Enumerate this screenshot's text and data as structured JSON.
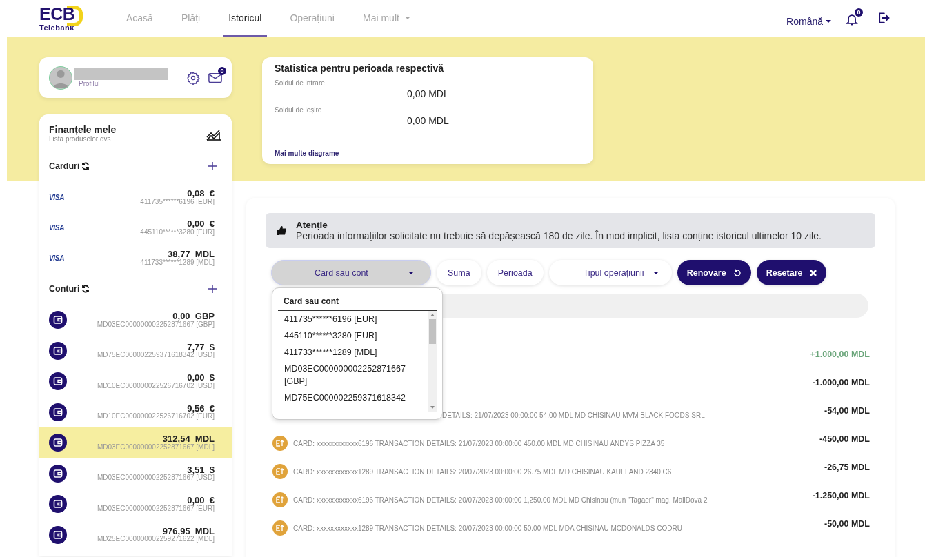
{
  "logo": {
    "title": "ECB",
    "subtitle": "Telebank"
  },
  "nav": [
    {
      "label": "Acasă",
      "selected": false,
      "kind": "link"
    },
    {
      "label": "Plăți",
      "selected": false,
      "kind": "link"
    },
    {
      "label": "Istoricul",
      "selected": true,
      "kind": "link"
    },
    {
      "label": "Operațiuni",
      "selected": false,
      "kind": "link"
    },
    {
      "label": "Mai mult",
      "selected": false,
      "kind": "menu"
    }
  ],
  "language": "Română",
  "notifications": {
    "count": "0"
  },
  "profile": {
    "label": "Profilul",
    "messages": "0"
  },
  "finances": {
    "title": "Finanțele mele",
    "subtitle": "Lista produselor dvs",
    "cards_title": "Carduri",
    "cards": [
      {
        "brand": "VISA",
        "amount": "0,08",
        "currency": "€",
        "number": "411735******6196 [EUR]"
      },
      {
        "brand": "VISA",
        "amount": "0,00",
        "currency": "€",
        "number": "445110******3280 [EUR]"
      },
      {
        "brand": "VISA",
        "amount": "38,77",
        "currency": "MDL",
        "number": "411733******1289 [MDL]"
      }
    ],
    "accounts_title": "Conturi",
    "accounts": [
      {
        "amount": "0,00",
        "currency": "GBP",
        "number": "MD03EC000000002252871667 [GBP]",
        "selected": false
      },
      {
        "amount": "7,77",
        "currency": "$",
        "number": "MD75EC000002259371618342 [USD]",
        "selected": false
      },
      {
        "amount": "0,00",
        "currency": "$",
        "number": "MD10EC000000022526716702 [USD]",
        "selected": false
      },
      {
        "amount": "9,56",
        "currency": "€",
        "number": "MD10EC000000022526716702 [EUR]",
        "selected": false
      },
      {
        "amount": "312,54",
        "currency": "MDL",
        "number": "MD03EC000000002252871667 [MDL]",
        "selected": true
      },
      {
        "amount": "3,51",
        "currency": "$",
        "number": "MD03EC000000002252871667 [USD]",
        "selected": false
      },
      {
        "amount": "0,00",
        "currency": "€",
        "number": "MD03EC000000002252871667 [EUR]",
        "selected": false
      },
      {
        "amount": "976,95",
        "currency": "MDL",
        "number": "MD25EC000000002259271622 [MDL]",
        "selected": false
      }
    ]
  },
  "stats": {
    "title": "Statistica pentru perioada respectivă",
    "rows": [
      {
        "label": "Soldul de intrare",
        "value": "0,00 MDL"
      },
      {
        "label": "Soldul de ieșire",
        "value": "0,00 MDL"
      }
    ],
    "link": "Mai multe diagrame"
  },
  "alert": {
    "title": "Atenție",
    "text": "Perioada informațiilor solicitate nu trebuie să depășească 180 de zile. În mod implicit, lista conține istoricul ultimelor 10 zile."
  },
  "filters": [
    {
      "label": "Card sau cont",
      "kind": "select",
      "selected": true
    },
    {
      "label": "Suma",
      "kind": "button",
      "selected": false
    },
    {
      "label": "Perioada",
      "kind": "button",
      "selected": false
    },
    {
      "label": "Tipul operațiunii",
      "kind": "select",
      "selected": false
    },
    {
      "label": "Renovare",
      "kind": "refresh",
      "selected": false
    },
    {
      "label": "Resetare",
      "kind": "reset",
      "selected": false
    }
  ],
  "dropdown": {
    "title": "Card sau cont",
    "options": [
      "411735******6196 [EUR]",
      "445110******3280 [EUR]",
      "411733******1289 [MDL]",
      "MD03EC000000002252871667 [GBP]",
      "MD75EC000002259371618342"
    ]
  },
  "transactions": [
    {
      "amount": "+1.000,00 MDL"
    },
    {
      "amount": "-1.000,00 MDL"
    },
    {
      "description": "DETAILS: 21/07/2023 00:00:00 54.00 MDL MD CHISINAU MVM BLACK FOODS SRL",
      "amount": "-54,00 MDL",
      "partly_hidden": true
    },
    {
      "description": "CARD: xxxxxxxxxxxx6196 TRANSACTION DETAILS: 21/07/2023 00:00:00 450.00 MDL MD CHISINAU ANDYS PIZZA 35",
      "amount": "-450,00 MDL",
      "partly_hidden": false
    },
    {
      "description": "CARD: xxxxxxxxxxxx1289 TRANSACTION DETAILS: 20/07/2023 00:00:00 26.75 MDL MD CHISINAU KAUFLAND 2340 C6",
      "amount": "-26,75 MDL",
      "partly_hidden": false
    },
    {
      "description": "CARD: xxxxxxxxxxxx6196 TRANSACTION DETAILS: 20/07/2023 00:00:00 1,250.00 MDL MD Chisinau (mun \"Tagaer\" mag. MallDova 2",
      "amount": "-1.250,00 MDL",
      "partly_hidden": false
    },
    {
      "description": "CARD: xxxxxxxxxxxx1289 TRANSACTION DETAILS: 20/07/2023 00:00:00 50.00 MDL MDA CHISINAU MCDONALDS CODRU",
      "amount": "-50,00 MDL",
      "partly_hidden": false
    }
  ]
}
